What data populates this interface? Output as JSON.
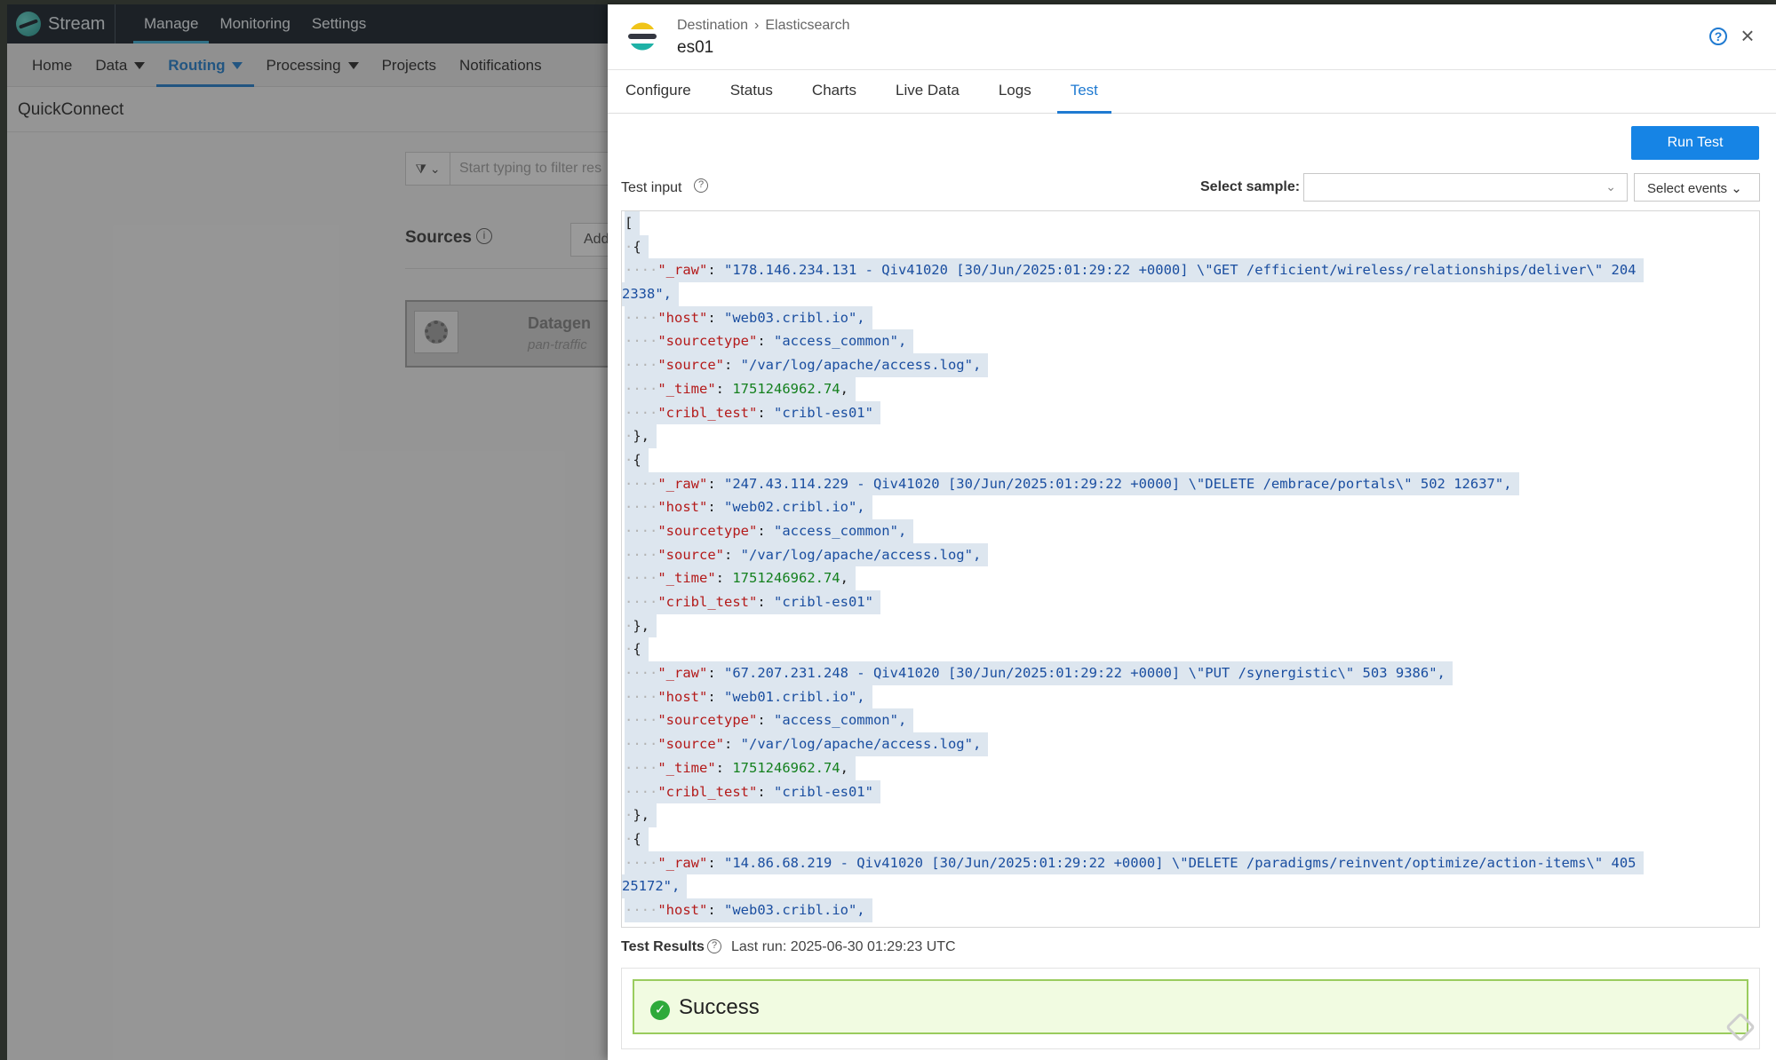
{
  "app": {
    "logo_name": "Stream",
    "top_nav": [
      "Manage",
      "Monitoring",
      "Settings"
    ],
    "active_top_nav": "Manage",
    "sub_nav": {
      "home": "Home",
      "data": "Data",
      "routing": "Routing",
      "processing": "Processing",
      "projects": "Projects",
      "notifications": "Notifications"
    },
    "page_title": "QuickConnect",
    "filter_placeholder": "Start typing to filter res",
    "sources_label": "Sources",
    "add_button": "Add",
    "source_card": {
      "name": "Datagen",
      "subtitle": "pan-traffic"
    }
  },
  "panel": {
    "breadcrumb": [
      "Destination",
      "Elasticsearch"
    ],
    "title": "es01",
    "tabs": [
      "Configure",
      "Status",
      "Charts",
      "Live Data",
      "Logs",
      "Test"
    ],
    "active_tab": "Test",
    "run_test_label": "Run Test",
    "test_input_label": "Test input",
    "select_sample_label": "Select sample:",
    "select_sample_value": "",
    "select_events_label": "Select events",
    "test_results_label": "Test Results",
    "last_run": "Last run: 2025-06-30 01:29:23 UTC",
    "result_status": "Success",
    "colors": {
      "accent": "#1f7ad1",
      "run_button": "#1684e5",
      "success_bg": "#f1fbe1",
      "success_border": "#9acc5e"
    }
  },
  "editor": {
    "events": [
      {
        "_raw": "\"178.146.234.131 - Qiv41020 [30/Jun/2025:01:29:22 +0000] \\\"GET /efficient/wireless/relationships/deliver\\\" 204",
        "_raw_wrap": "2338\",",
        "host": "\"web03.cribl.io\",",
        "sourcetype": "\"access_common\",",
        "source": "\"/var/log/apache/access.log\",",
        "_time": "1751246962.74",
        "cribl_test": "\"cribl-es01\""
      },
      {
        "_raw": "\"247.43.114.229 - Qiv41020 [30/Jun/2025:01:29:22 +0000] \\\"DELETE /embrace/portals\\\" 502 12637\",",
        "host": "\"web02.cribl.io\",",
        "sourcetype": "\"access_common\",",
        "source": "\"/var/log/apache/access.log\",",
        "_time": "1751246962.74",
        "cribl_test": "\"cribl-es01\""
      },
      {
        "_raw": "\"67.207.231.248 - Qiv41020 [30/Jun/2025:01:29:22 +0000] \\\"PUT /synergistic\\\" 503 9386\",",
        "host": "\"web01.cribl.io\",",
        "sourcetype": "\"access_common\",",
        "source": "\"/var/log/apache/access.log\",",
        "_time": "1751246962.74",
        "cribl_test": "\"cribl-es01\""
      },
      {
        "_raw": "\"14.86.68.219 - Qiv41020 [30/Jun/2025:01:29:22 +0000] \\\"DELETE /paradigms/reinvent/optimize/action-items\\\" 405",
        "_raw_wrap": "25172\",",
        "host": "\"web03.cribl.io\","
      }
    ]
  }
}
